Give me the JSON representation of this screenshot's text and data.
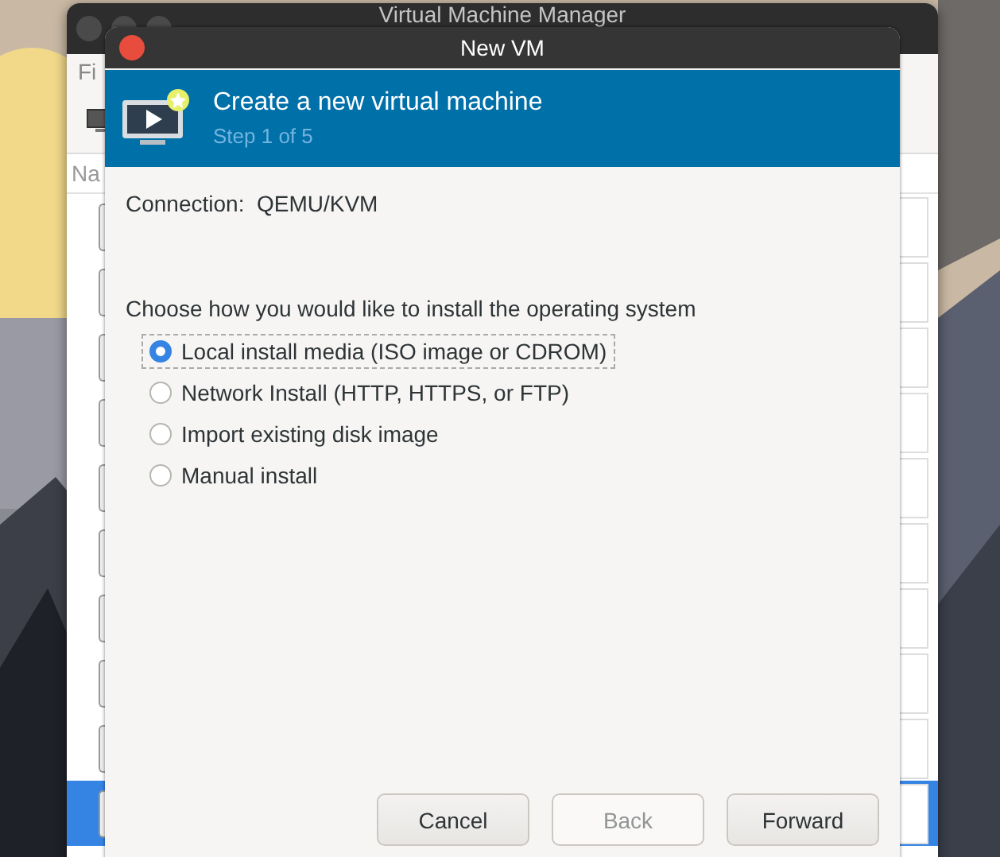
{
  "background_window": {
    "title": "Virtual Machine Manager",
    "menu_label": "Fi",
    "column_header": "Na",
    "rows": [
      {
        "selected": false
      },
      {
        "selected": false
      },
      {
        "selected": false
      },
      {
        "selected": false
      },
      {
        "selected": false
      },
      {
        "selected": false
      },
      {
        "selected": false
      },
      {
        "selected": false
      },
      {
        "selected": false
      },
      {
        "selected": true
      }
    ]
  },
  "dialog": {
    "title": "New VM",
    "header": {
      "title": "Create a new virtual machine",
      "subtitle": "Step 1 of 5"
    },
    "connection": {
      "label": "Connection:",
      "value": "QEMU/KVM"
    },
    "prompt": "Choose how you would like to install the operating system",
    "options": [
      {
        "label": "Local install media (ISO image or CDROM)",
        "selected": true
      },
      {
        "label": "Network Install (HTTP, HTTPS, or FTP)",
        "selected": false
      },
      {
        "label": "Import existing disk image",
        "selected": false
      },
      {
        "label": "Manual install",
        "selected": false
      }
    ],
    "buttons": [
      {
        "label": "Cancel",
        "disabled": false
      },
      {
        "label": "Back",
        "disabled": true
      },
      {
        "label": "Forward",
        "disabled": false
      }
    ]
  }
}
